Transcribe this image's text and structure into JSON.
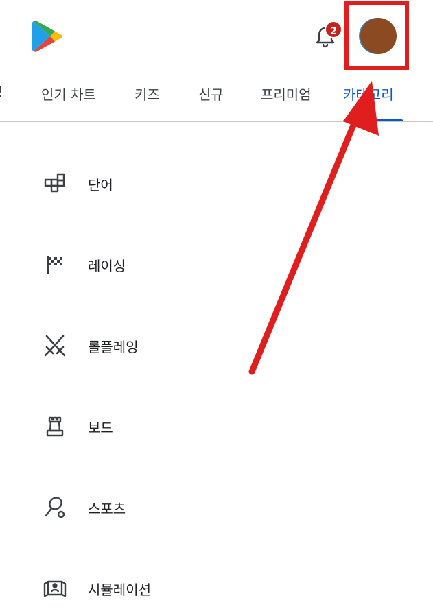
{
  "tabs": [
    {
      "label": "!"
    },
    {
      "label": "인기 차트"
    },
    {
      "label": "키즈"
    },
    {
      "label": "신규"
    },
    {
      "label": "프리미엄"
    },
    {
      "label": "카테고리",
      "active": true
    }
  ],
  "notifications": {
    "count": "2"
  },
  "categories": [
    {
      "label": "단어",
      "icon": "word-icon"
    },
    {
      "label": "레이싱",
      "icon": "racing-flag-icon"
    },
    {
      "label": "롤플레잉",
      "icon": "crossed-swords-icon"
    },
    {
      "label": "보드",
      "icon": "chess-piece-icon"
    },
    {
      "label": "스포츠",
      "icon": "racket-icon"
    },
    {
      "label": "시뮬레이션",
      "icon": "simulation-icon"
    }
  ],
  "colors": {
    "accent": "#0b57d0",
    "highlight": "#e01e1e",
    "badge": "#c5221f",
    "avatar": "#8b4a22"
  }
}
